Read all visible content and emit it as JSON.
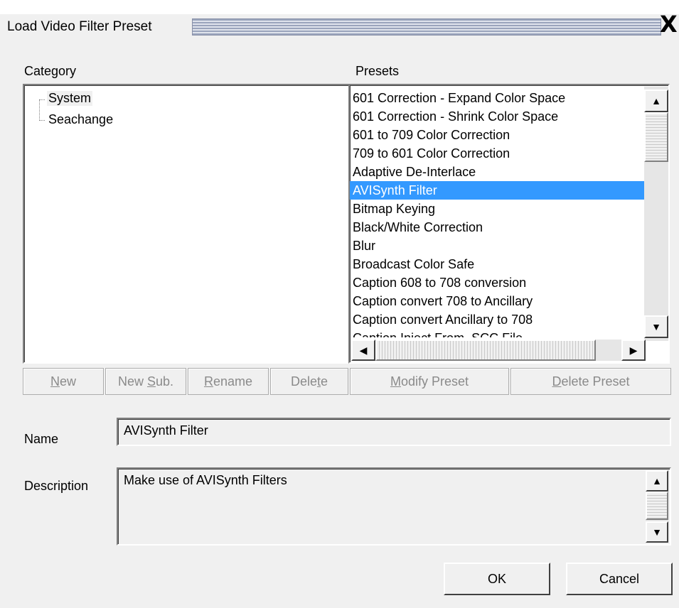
{
  "window": {
    "title": "Load Video Filter Preset",
    "close_glyph": "X"
  },
  "category": {
    "label": "Category",
    "items": [
      "System",
      "Seachange"
    ]
  },
  "presets": {
    "label": "Presets",
    "selected_index": 5,
    "items": [
      "601 Correction - Expand Color Space",
      "601 Correction - Shrink Color Space",
      "601 to 709 Color Correction",
      "709 to 601 Color Correction",
      "Adaptive De-Interlace",
      "AVISynth Filter",
      "Bitmap Keying",
      "Black/White Correction",
      "Blur",
      "Broadcast Color Safe",
      "Caption 608 to 708 conversion",
      "Caption convert 708 to Ancillary",
      "Caption convert Ancillary to 708",
      "Caption Inject From .SCC File"
    ]
  },
  "buttons": {
    "new": {
      "pre": "",
      "u": "N",
      "post": "ew"
    },
    "new_sub": {
      "pre": "New ",
      "u": "S",
      "post": "ub."
    },
    "rename": {
      "pre": "",
      "u": "R",
      "post": "ename"
    },
    "delete": {
      "pre": "Dele",
      "u": "t",
      "post": "e"
    },
    "modify_preset": {
      "pre": "",
      "u": "M",
      "post": "odify Preset"
    },
    "delete_preset": {
      "pre": "",
      "u": "D",
      "post": "elete Preset"
    },
    "ok": "OK",
    "cancel": "Cancel"
  },
  "form": {
    "name_label": "Name",
    "name_value": "AVISynth Filter",
    "description_label": "Description",
    "description_value": "Make use of AVISynth Filters"
  },
  "icons": {
    "scroll_up": "▲",
    "scroll_down": "▼",
    "scroll_left": "◀",
    "scroll_right": "▶"
  },
  "colors": {
    "selection": "#3399ff",
    "window_bg": "#f0f0f0"
  }
}
